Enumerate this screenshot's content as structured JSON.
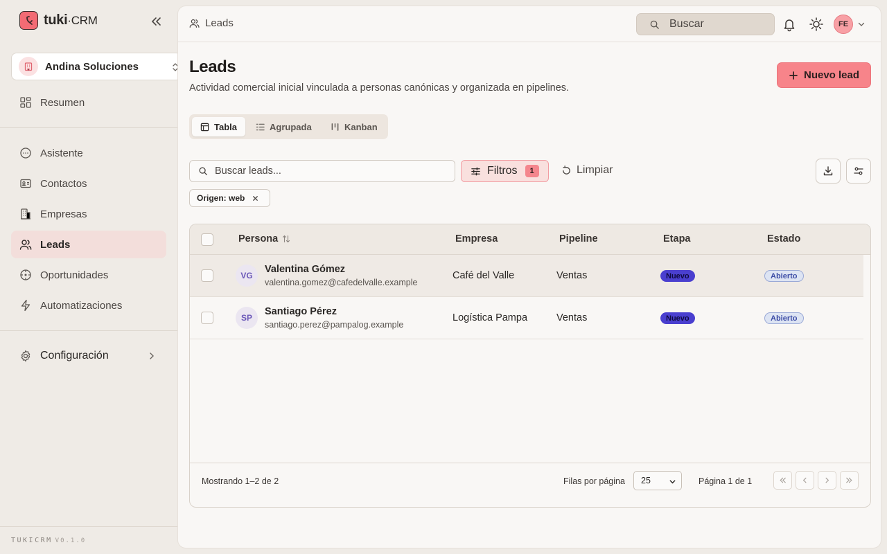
{
  "brand": {
    "name": "tuki",
    "suffix": "CRM"
  },
  "workspace": {
    "name": "Andina Soluciones"
  },
  "nav": {
    "resumen": "Resumen",
    "asistente": "Asistente",
    "contactos": "Contactos",
    "empresas": "Empresas",
    "leads": "Leads",
    "oportunidades": "Oportunidades",
    "automatizaciones": "Automatizaciones",
    "configuracion": "Configuración"
  },
  "footer": {
    "name": "TUKICRM",
    "version": "V0.1.0"
  },
  "topbar": {
    "breadcrumb": "Leads",
    "search_label": "Buscar",
    "avatar_initials": "FE"
  },
  "page": {
    "title": "Leads",
    "subtitle": "Actividad comercial inicial vinculada a personas canónicas y organizada en pipelines.",
    "new_button": "Nuevo lead"
  },
  "view_tabs": {
    "tabla": "Tabla",
    "agrupada": "Agrupada",
    "kanban": "Kanban",
    "active": "Tabla"
  },
  "toolbar": {
    "search_placeholder": "Buscar leads...",
    "filters_label": "Filtros",
    "filters_count": "1",
    "clear_label": "Limpiar"
  },
  "active_filter": {
    "label": "Origen: web"
  },
  "table": {
    "columns": {
      "persona": "Persona",
      "empresa": "Empresa",
      "pipeline": "Pipeline",
      "etapa": "Etapa",
      "estado": "Estado"
    },
    "rows": [
      {
        "initials": "VG",
        "name": "Valentina Gómez",
        "email": "valentina.gomez@cafedelvalle.example",
        "empresa": "Café del Valle",
        "pipeline": "Ventas",
        "etapa": "Nuevo",
        "estado": "Abierto"
      },
      {
        "initials": "SP",
        "name": "Santiago Pérez",
        "email": "santiago.perez@pampalog.example",
        "empresa": "Logística Pampa",
        "pipeline": "Ventas",
        "etapa": "Nuevo",
        "estado": "Abierto"
      }
    ]
  },
  "pagination": {
    "showing": "Mostrando 1–2 de 2",
    "rows_per_page_label": "Filas por página",
    "rows_per_page": "25",
    "page_info": "Página 1 de 1"
  },
  "colors": {
    "accent": "#f7848a",
    "stage": "#4a3fcf",
    "status": "#dde4f3"
  }
}
